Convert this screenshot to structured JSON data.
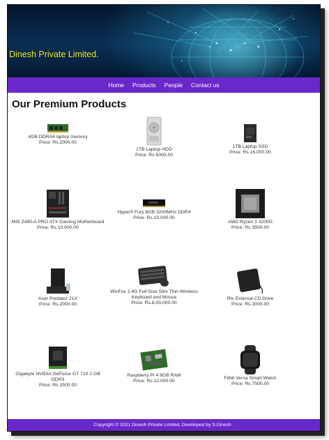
{
  "brand": "Dinesh Private Limited.",
  "nav": {
    "items": [
      "Home",
      "Products",
      "People",
      "Contact us"
    ]
  },
  "main": {
    "title": "Our Premium Products",
    "products": [
      {
        "name": "4GB DDRA4 laptop memory",
        "price": "Price: Rs.2000.00",
        "icon": "ram-module-icon"
      },
      {
        "name": "1TB Laptop HDD",
        "price": "Price: Rs.5000.00",
        "icon": "hard-drive-icon"
      },
      {
        "name": "1TB Laptop SSD",
        "price": "Price: Rs.16,000.00",
        "icon": "ssd-icon"
      },
      {
        "name": "MSI Z490-A PRO ATX Gaming Motherboard",
        "price": "Price: Rs.10,000.00",
        "icon": "motherboard-icon"
      },
      {
        "name": "HyperX Fury 8GB 3200MHz DDR4",
        "price": "Price: Rs.10,000.00",
        "icon": "ram-stick-icon"
      },
      {
        "name": "AMD Ryzen 3 3200G",
        "price": "Price: Rs.3500.00",
        "icon": "cpu-icon"
      },
      {
        "name": "Acer Predator 21X",
        "price": "Price: Rs.2000.00",
        "icon": "laptop-icon"
      },
      {
        "name": "WisFox 2.4G Full-Size Slim Thin Wireless Keyboard and Mouse",
        "price": "Price: Rs.8,00,000.00",
        "icon": "keyboard-mouse-icon"
      },
      {
        "name": "Rts External CD Drive",
        "price": "Price: Rs.3000.00",
        "icon": "cd-drive-icon"
      },
      {
        "name": "Gigabyte NVIDIA GeForce GT 710 2 GB DDR3",
        "price": "Price: Rs.1500.00",
        "icon": "graphics-card-icon"
      },
      {
        "name": "Raspberry Pi 4 8GB RAM",
        "price": "Price: Rs.12,000.00",
        "icon": "raspberry-pi-icon"
      },
      {
        "name": "Fitbit Versa Smart Watch",
        "price": "Price: Rs.7500.00",
        "icon": "smartwatch-icon"
      }
    ]
  },
  "footer": {
    "text": "Copyright © 2021 Dinesh Private Limited, Developed by S.Dinesh ."
  },
  "colors": {
    "nav_background": "#6a27c9",
    "brand_text": "#f2ef2a",
    "header_background": "#0a2f55"
  }
}
